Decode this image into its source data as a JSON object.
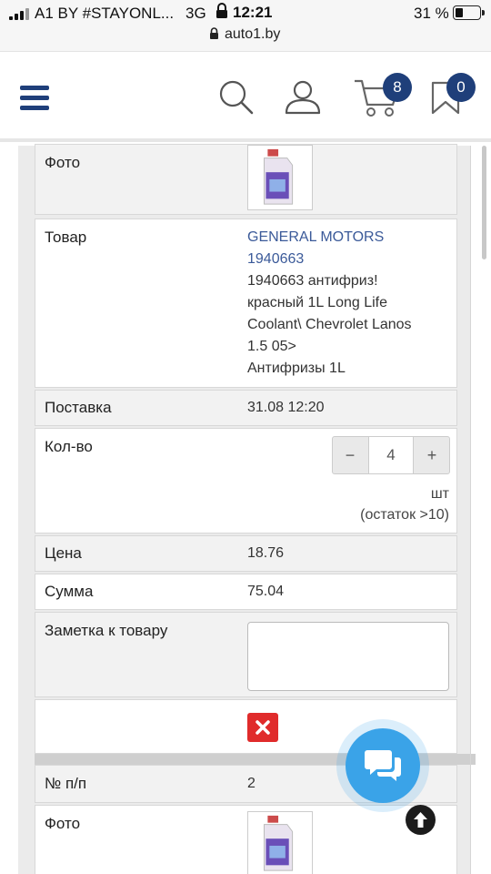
{
  "status_bar": {
    "carrier": "A1 BY #STAYONL...",
    "network": "3G",
    "time": "12:21",
    "battery_percent": "31 %"
  },
  "browser": {
    "url": "auto1.by"
  },
  "header": {
    "cart_count": "8",
    "favorites_count": "0",
    "brand_color": "#1f3f7a"
  },
  "items": [
    {
      "photo_label": "Фото",
      "product_label": "Товар",
      "brand_link": "GENERAL MOTORS",
      "article_link": "1940663",
      "description_lines": [
        "1940663 антифриз!",
        "красный 1L Long Life",
        "Coolant\\ Chevrolet Lanos",
        "1.5 05>",
        "Антифризы 1L"
      ],
      "delivery_label": "Поставка",
      "delivery_value": "31.08 12:20",
      "qty_label": "Кол-во",
      "qty_minus": "−",
      "qty_value": "4",
      "qty_plus": "+",
      "qty_unit": "шт",
      "qty_stock": "(остаток >10)",
      "price_label": "Цена",
      "price_value": "18.76",
      "sum_label": "Сумма",
      "sum_value": "75.04",
      "note_label": "Заметка к товару",
      "note_value": ""
    },
    {
      "number_label": "№ п/п",
      "number_value": "2",
      "photo_label": "Фото"
    }
  ],
  "icons": {
    "menu": "hamburger-menu-icon",
    "search": "search-icon",
    "user": "user-icon",
    "cart": "cart-icon",
    "favorites": "bookmark-icon",
    "delete": "close-x-icon",
    "chat": "chat-bubbles-icon",
    "scroll_top": "arrow-up-icon"
  },
  "colors": {
    "link": "#3b5a99",
    "delete": "#e02b2b",
    "chat": "#3aa3e8"
  }
}
